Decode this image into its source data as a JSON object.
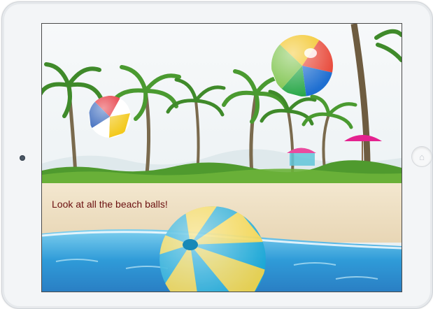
{
  "app": {
    "caption": "Look at all the beach balls!"
  },
  "device": {
    "home_button_glyph": "⌂",
    "icons": [
      "front-camera-icon",
      "home-button-icon"
    ]
  },
  "scene": {
    "balls": [
      {
        "name": "beach-ball-top-right",
        "colors": [
          "#f2c21b",
          "#2aa84a",
          "#1f6fd1",
          "#e8493a",
          "#ffffff"
        ]
      },
      {
        "name": "beach-ball-left",
        "colors": [
          "#e3222c",
          "#ffffff",
          "#2d5fb8",
          "#f3c91d"
        ]
      },
      {
        "name": "beach-ball-bottom",
        "colors": [
          "#1aa8d6",
          "#f3d54a"
        ]
      }
    ],
    "colors": {
      "sky": "#f4f7f8",
      "foliage": "#4f9a2e",
      "sand": "#efe1c5",
      "water": "#2f9bd8",
      "umbrella": "#e4228f"
    }
  }
}
